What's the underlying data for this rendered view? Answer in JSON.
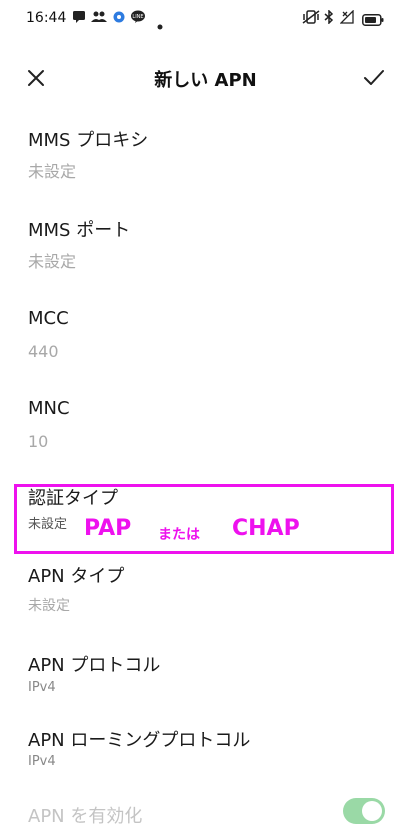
{
  "status_bar": {
    "time": "16:44",
    "icons": [
      "message-icon",
      "group-icon",
      "settings-gear-icon",
      "line-app-icon",
      "dot-icon",
      "vibrate-icon",
      "bluetooth-icon",
      "no-signal-icon",
      "battery-icon"
    ]
  },
  "app_bar": {
    "title": "新しい APN",
    "close_icon": "close-icon",
    "save_icon": "check-icon"
  },
  "settings": {
    "mms_proxy": {
      "label": "MMS プロキシ",
      "value": "未設定"
    },
    "mms_port": {
      "label": "MMS ポート",
      "value": "未設定"
    },
    "mcc": {
      "label": "MCC",
      "value": "440"
    },
    "mnc": {
      "label": "MNC",
      "value": "10"
    },
    "auth_type": {
      "label": "認証タイプ",
      "value": "未設定"
    },
    "apn_type": {
      "label": "APN タイプ",
      "value": "未設定"
    },
    "apn_protocol": {
      "label": "APN プロトコル",
      "value": "IPv4"
    },
    "apn_roaming_protocol": {
      "label": "APN ローミングプロトコル",
      "value": "IPv4"
    },
    "apn_enable": {
      "label": "APN を有効化",
      "enabled": true
    }
  },
  "annotation": {
    "pap": "PAP",
    "or": "または",
    "chap": "CHAP",
    "color": "#ee11ee"
  },
  "colors": {
    "toggle_on": "#9ad9a6",
    "value_gray": "#a8a8a8"
  }
}
